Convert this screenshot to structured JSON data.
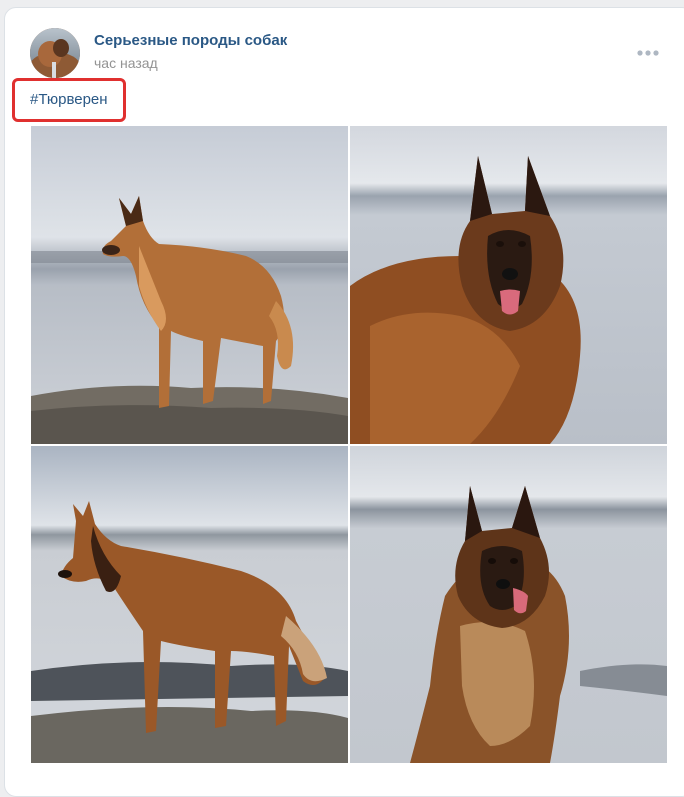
{
  "post": {
    "author_name": "Серьезные породы собак",
    "time": "час назад",
    "hashtag": "#Тюрверен",
    "more_icon": "more-horizontal-icon",
    "photos": [
      {
        "name": "photo-tervuren-standing-rock"
      },
      {
        "name": "photo-tervuren-portrait-tongue"
      },
      {
        "name": "photo-tervuren-side-profile"
      },
      {
        "name": "photo-tervuren-sitting-portrait"
      }
    ]
  },
  "colors": {
    "link": "#2a5885",
    "muted": "#939393",
    "highlight": "#e0302f",
    "page_bg": "#edeef0"
  }
}
